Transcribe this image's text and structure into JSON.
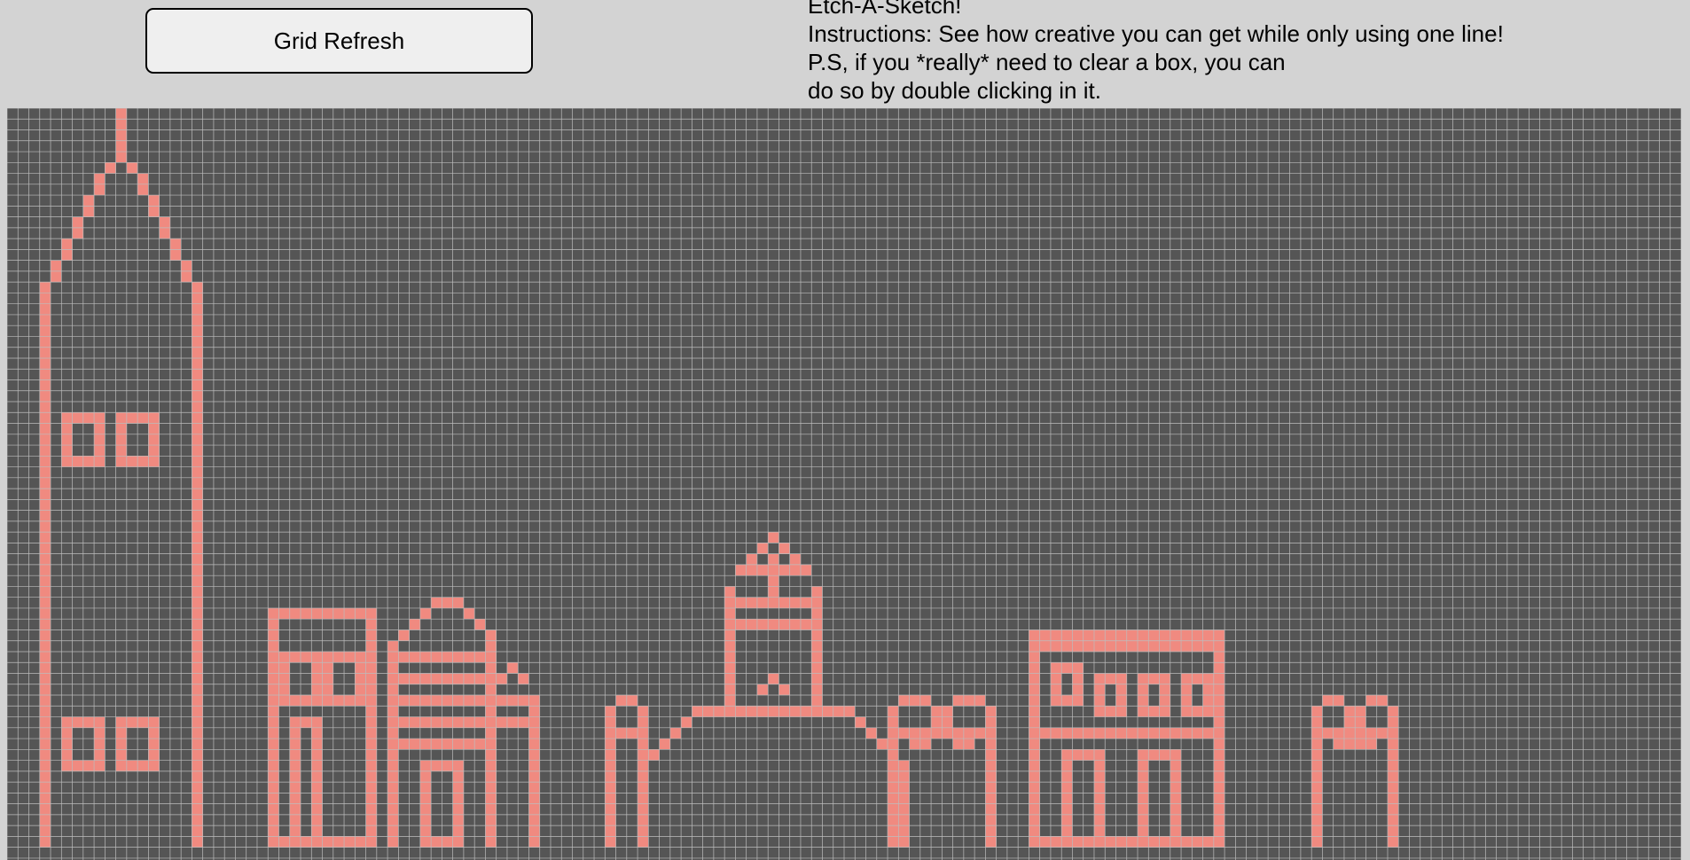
{
  "header": {
    "refresh_button_label": "Grid Refresh",
    "title": "Etch-A-Sketch!",
    "instructions_line1": "Instructions: See how creative you can get while only using one line!",
    "instructions_line2": "P.S, if you *really* need to clear a box, you can",
    "instructions_line3": "do so by double clicking in it."
  },
  "grid": {
    "columns": 154,
    "visible_rows": 68,
    "cell_color": "#555555",
    "line_color": "#bdbdbd",
    "drawn_color": "#f08a80"
  }
}
